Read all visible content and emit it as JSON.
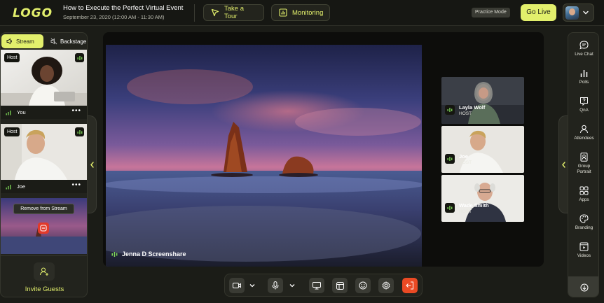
{
  "header": {
    "logo": "LOGO",
    "event_title": "How to Execute the Perfect Virtual Event",
    "event_date": "September 23, 2020 (12:00 AM - 11:30 AM)",
    "tour_label": "Take a Tour",
    "monitoring_label": "Monitoring",
    "practice_label": "Practice Mode",
    "golive_label": "Go Live"
  },
  "left_panel": {
    "tabs": [
      {
        "label": "Stream"
      },
      {
        "label": "Backstage"
      }
    ],
    "tiles": [
      {
        "host_tag": "Host",
        "name": "You",
        "more": "•••"
      },
      {
        "host_tag": "Host",
        "name": "Joe",
        "more": "•••"
      }
    ],
    "tooltip": "Remove from Stream",
    "invite_label": "Invite Guests"
  },
  "stage": {
    "screenshare_label": "Jenna D Screenshare",
    "participants": [
      {
        "name": "Layla Wolf",
        "role": "HOST"
      },
      {
        "name": "Joe",
        "role": "HOST"
      },
      {
        "name": "Wade Smith",
        "role": "HOST"
      }
    ]
  },
  "right_sidebar": {
    "items": [
      {
        "label": "Live Chat",
        "icon": "chat-icon"
      },
      {
        "label": "Polls",
        "icon": "polls-icon"
      },
      {
        "label": "QnA",
        "icon": "qna-icon"
      },
      {
        "label": "Attendees",
        "icon": "attendees-icon"
      },
      {
        "label": "Group Portrait",
        "icon": "portrait-icon"
      },
      {
        "label": "Apps",
        "icon": "apps-icon"
      },
      {
        "label": "Branding",
        "icon": "palette-icon"
      },
      {
        "label": "Videos",
        "icon": "video-icon"
      }
    ]
  },
  "colors": {
    "accent": "#e2ef6c",
    "background": "#1b1c17",
    "panel": "#22231d",
    "exit": "#ea4a24"
  }
}
